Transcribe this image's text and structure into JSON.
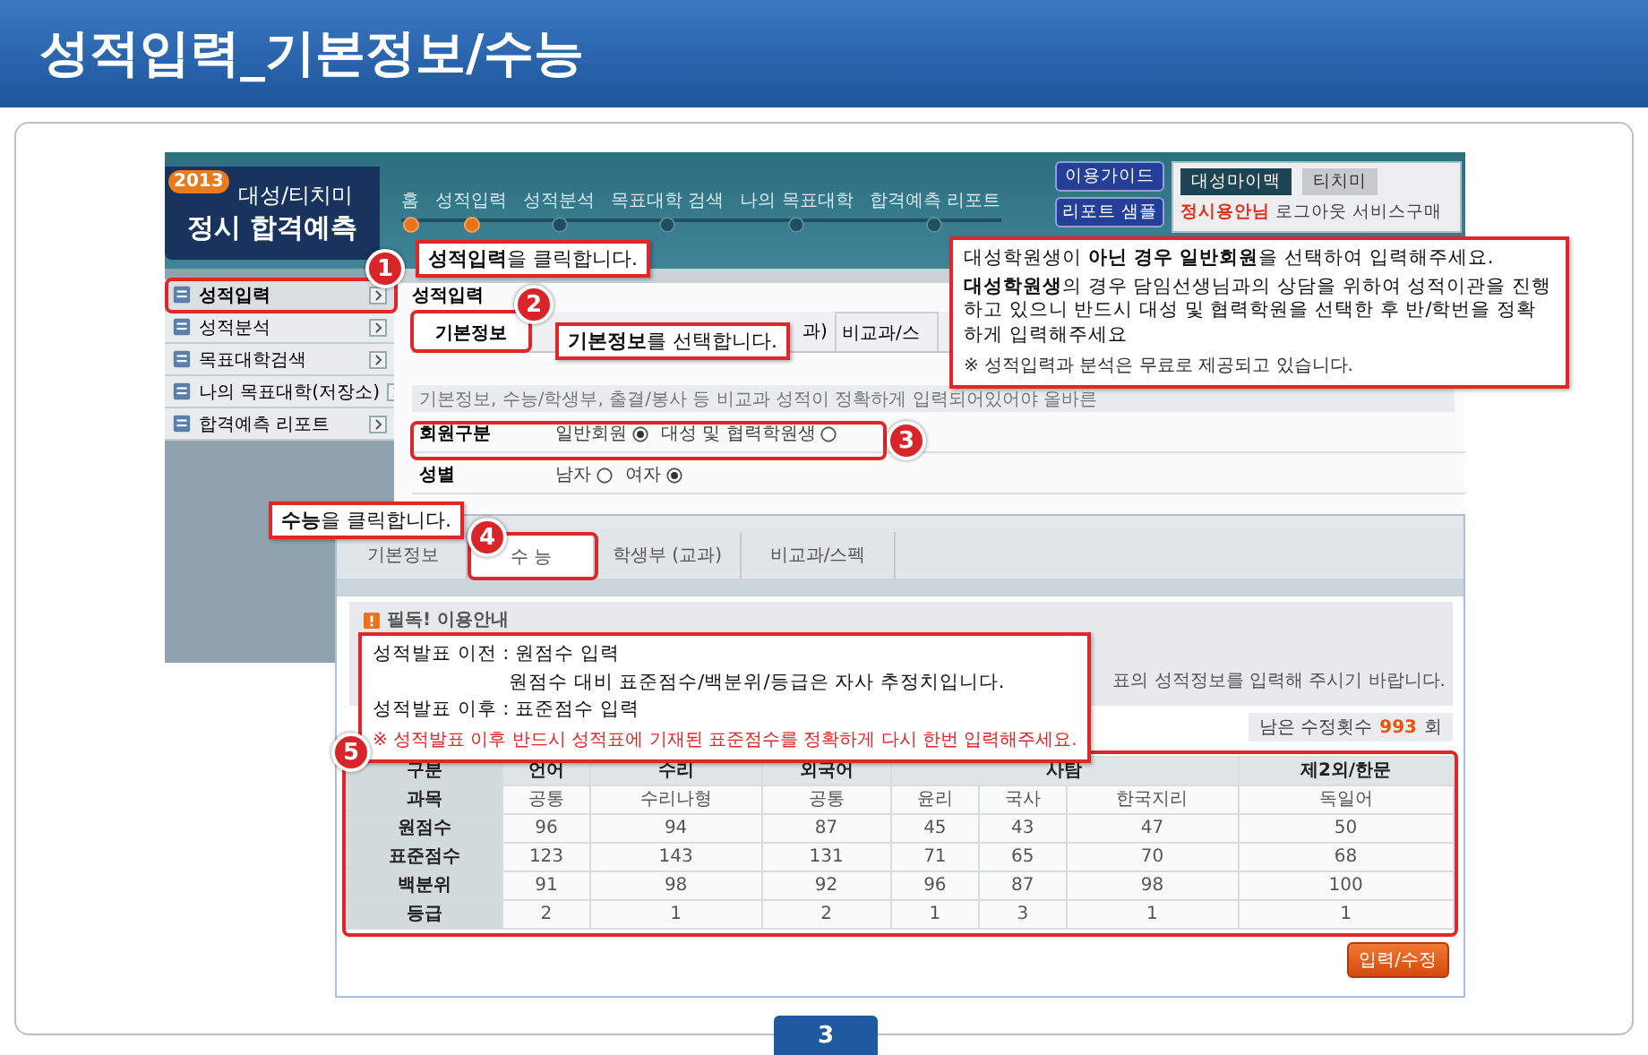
{
  "slide_title": "성적입력_기본정보/수능",
  "page_number": "3",
  "site": {
    "logo": {
      "year": "2013",
      "line1": "대성/티치미",
      "line2": "정시 합격예측"
    },
    "steps": [
      {
        "label": "홈",
        "done": true
      },
      {
        "label": "성적입력",
        "done": true
      },
      {
        "label": "성적분석",
        "done": false
      },
      {
        "label": "목표대학 검색",
        "done": false
      },
      {
        "label": "나의 목표대학",
        "done": false
      },
      {
        "label": "합격예측 리포트",
        "done": false
      }
    ],
    "header_buttons": [
      "이용가이드",
      "리포트 샘플"
    ],
    "brand_tabs": [
      {
        "label": "대성마이맥",
        "selected": true
      },
      {
        "label": "티치미",
        "selected": false
      }
    ],
    "user": {
      "name": "정시용안님",
      "links": [
        "로그아웃",
        "서비스구매"
      ]
    },
    "sidebar": [
      {
        "label": "성적입력",
        "selected": true
      },
      {
        "label": "성적분석",
        "selected": false
      },
      {
        "label": "목표대학검색",
        "selected": false
      },
      {
        "label": "나의 목표대학(저장소)",
        "selected": false
      },
      {
        "label": "합격예측 리포트",
        "selected": false
      }
    ],
    "section_title": "성적입력",
    "tabs": [
      {
        "label": "기본정보",
        "selected": true
      },
      {
        "label": "과)",
        "selected": false
      },
      {
        "label": "비교과/스",
        "selected": false
      }
    ],
    "notice": "기본정보, 수능/학생부, 출결/봉사 등 비교과 성적이 정확하게 입력되어있어야 올바른",
    "form_rows": [
      {
        "label": "회원구분",
        "options": [
          {
            "label": "일반회원",
            "selected": true
          },
          {
            "label": "대성 및 협력학원생",
            "selected": false
          }
        ]
      },
      {
        "label": "성별",
        "options": [
          {
            "label": "남자",
            "selected": false
          },
          {
            "label": "여자",
            "selected": true
          }
        ]
      }
    ]
  },
  "suneung_panel": {
    "tabs": [
      {
        "label": "기본정보",
        "selected": false
      },
      {
        "label": "수 능",
        "selected": true
      },
      {
        "label": "학생부 (교과)",
        "selected": false
      },
      {
        "label": "비교과/스펙",
        "selected": false
      }
    ],
    "notice_title": "필독! 이용안내",
    "notice_text": "표의 성적정보를 입력해 주시기 바랍니다.",
    "remaining": {
      "label": "남은 수정횟수",
      "count": "993",
      "unit": "회"
    },
    "table": {
      "corner": "구분",
      "subject_label": "과목",
      "areas": [
        {
          "name": "언어",
          "subjects": [
            "공통"
          ]
        },
        {
          "name": "수리",
          "subjects": [
            "수리나형"
          ]
        },
        {
          "name": "외국어",
          "subjects": [
            "공통"
          ]
        },
        {
          "name": "사탐",
          "subjects": [
            "윤리",
            "국사",
            "한국지리"
          ]
        },
        {
          "name": "제2외/한문",
          "subjects": [
            "독일어"
          ]
        }
      ],
      "rows": [
        {
          "label": "원점수",
          "cells": [
            "96",
            "94",
            "87",
            "45",
            "43",
            "47",
            "50"
          ]
        },
        {
          "label": "표준점수",
          "cells": [
            "123",
            "143",
            "131",
            "71",
            "65",
            "70",
            "68"
          ]
        },
        {
          "label": "백분위",
          "cells": [
            "91",
            "98",
            "92",
            "96",
            "87",
            "98",
            "100"
          ]
        },
        {
          "label": "등급",
          "cells": [
            "2",
            "1",
            "2",
            "1",
            "3",
            "1",
            "1"
          ]
        }
      ]
    },
    "submit": "입력/수정"
  },
  "callouts": [
    {
      "number": "1",
      "kind": "label",
      "text": "**성적입력**을 클릭합니다."
    },
    {
      "number": "2",
      "kind": "label",
      "text": "**기본정보**를 선택합니다."
    },
    {
      "number": "3",
      "kind": "box",
      "lines": [
        {
          "text": "대성학원생이 **아닌 경우 일반회원**을 선택하여 입력해주세요.",
          "indent": false
        },
        {
          "text": "**대성학원생**의 경우 담임선생님과의 상담을 위하여 성적이관을 진행하고 있으니 반드시 대성 및 협력학원을 선택한 후 반/학번을 정확하게 입력해주세요",
          "indent": false
        }
      ],
      "note": "※ 성적입력과 분석은 무료로 제공되고 있습니다.",
      "note_warning": false
    },
    {
      "number": "4",
      "kind": "label",
      "text": "**수능**을 클릭합니다."
    },
    {
      "number": "5",
      "kind": "box",
      "lines": [
        {
          "text": "성적발표 이전 : 원점수 입력",
          "indent": false
        },
        {
          "text": "원점수 대비 표준점수/백분위/등급은 자사 추정치입니다.",
          "indent": true
        },
        {
          "text": "성적발표 이후 : 표준점수 입력",
          "indent": false
        }
      ],
      "note": "※ 성적발표 이후 반드시 성적표에 기재된 표준점수를 정확하게 다시 한번 입력해주세요.",
      "note_warning": true
    }
  ]
}
